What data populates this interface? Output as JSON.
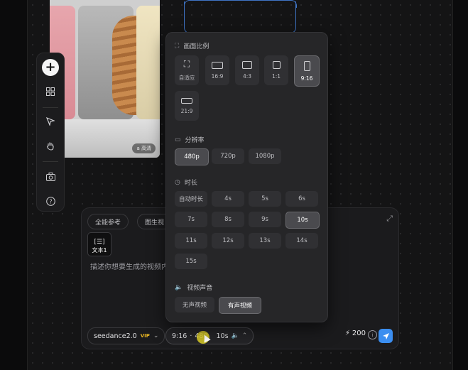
{
  "image_node": {
    "watermark": "a 高清"
  },
  "toolbar": {
    "items": [
      "add-icon",
      "grid-icon",
      "pointer-icon",
      "hand-icon",
      "camera-icon",
      "help-icon"
    ]
  },
  "composer": {
    "chips": [
      "全能参考",
      "图生视"
    ],
    "text_card_label": "文本1",
    "prompt_placeholder": "描述你想要生成的视频内",
    "model": "seedance2.0",
    "model_badge": "VIP",
    "config_ratio": "9:16",
    "config_sep": "·",
    "config_res": "480",
    "config_duration": "10s",
    "credits": "200",
    "accent_color": "#3b8ef0"
  },
  "popover": {
    "aspect": {
      "title": "画面比例",
      "options": [
        "自适应",
        "16:9",
        "4:3",
        "1:1",
        "9:16",
        "21:9"
      ],
      "selected": "9:16"
    },
    "resolution": {
      "title": "分辨率",
      "options": [
        "480p",
        "720p",
        "1080p"
      ],
      "selected": "480p"
    },
    "duration": {
      "title": "时长",
      "options": [
        "自动时长",
        "4s",
        "5s",
        "6s",
        "7s",
        "8s",
        "9s",
        "10s",
        "11s",
        "12s",
        "13s",
        "14s",
        "15s"
      ],
      "selected": "10s"
    },
    "audio": {
      "title": "视频声音",
      "options": [
        "无声视频",
        "有声视频"
      ],
      "selected": "有声视频"
    }
  }
}
